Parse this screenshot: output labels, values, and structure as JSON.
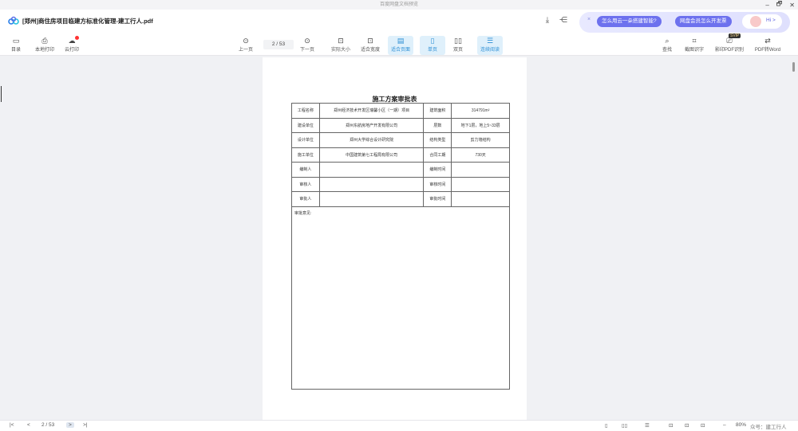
{
  "window": {
    "title": "百度网盘文档预览",
    "minimize": "–",
    "restore": "🗗",
    "close": "✕"
  },
  "header": {
    "file_title": "[郑州]商住房项目临建方标准化管理-建工行人.pdf",
    "promo_close": "×",
    "promo_1": "怎么用云一朵搭建智能?",
    "promo_2": "网盘会员怎么开发票",
    "hi_label": "Hi >"
  },
  "toolbar": {
    "left": [
      {
        "icon": "▭",
        "label": "目录"
      },
      {
        "icon": "⎙",
        "label": "本地打印"
      },
      {
        "icon": "☁",
        "label": "云打印"
      }
    ],
    "prev": {
      "icon": "⊙",
      "label": "上一页"
    },
    "page_indicator": "2 / 53",
    "next": {
      "icon": "⊙",
      "label": "下一页"
    },
    "view": [
      {
        "icon": "⊡",
        "label": "实际大小"
      },
      {
        "icon": "⊡",
        "label": "适合宽度"
      },
      {
        "icon": "▤",
        "label": "适合页面"
      },
      {
        "icon": "▯",
        "label": "单页"
      },
      {
        "icon": "▯▯",
        "label": "双页"
      },
      {
        "icon": "☰",
        "label": "连续阅读"
      }
    ],
    "right": [
      {
        "icon": "⌕",
        "label": "查找"
      },
      {
        "icon": "⌗",
        "label": "截图识字"
      },
      {
        "icon": "⎚",
        "label": "影印PDF识别"
      },
      {
        "icon": "⇄",
        "label": "PDF转Word"
      }
    ],
    "svip_badge": "SVIP"
  },
  "document": {
    "title": "施工方案审批表",
    "rows": [
      [
        "工程名称",
        "郑州经济技术开发区瑞馨小区（一期）项目",
        "建筑面积",
        "314791m²"
      ],
      [
        "建设单位",
        "郑州东航房地产开发有限公司",
        "层数",
        "地下1层，地上5~33层"
      ],
      [
        "设计单位",
        "郑州大学综合设计研究院",
        "结构类型",
        "剪力墙结构"
      ],
      [
        "施工单位",
        "中国建筑第七工程局有限公司",
        "合同工期",
        "730天"
      ],
      [
        "编制人",
        "",
        "编制时间",
        ""
      ],
      [
        "审核人",
        "",
        "审核时间",
        ""
      ],
      [
        "审批人",
        "",
        "审批时间",
        ""
      ]
    ],
    "opinion_label": "审批意见:"
  },
  "footer": {
    "first": "|<",
    "prev": "<",
    "page_indicator": "2 / 53",
    "next": ">",
    "last": ">|",
    "zoom_minus": "–",
    "zoom": "80%",
    "watermark": "众号：建工行人"
  }
}
